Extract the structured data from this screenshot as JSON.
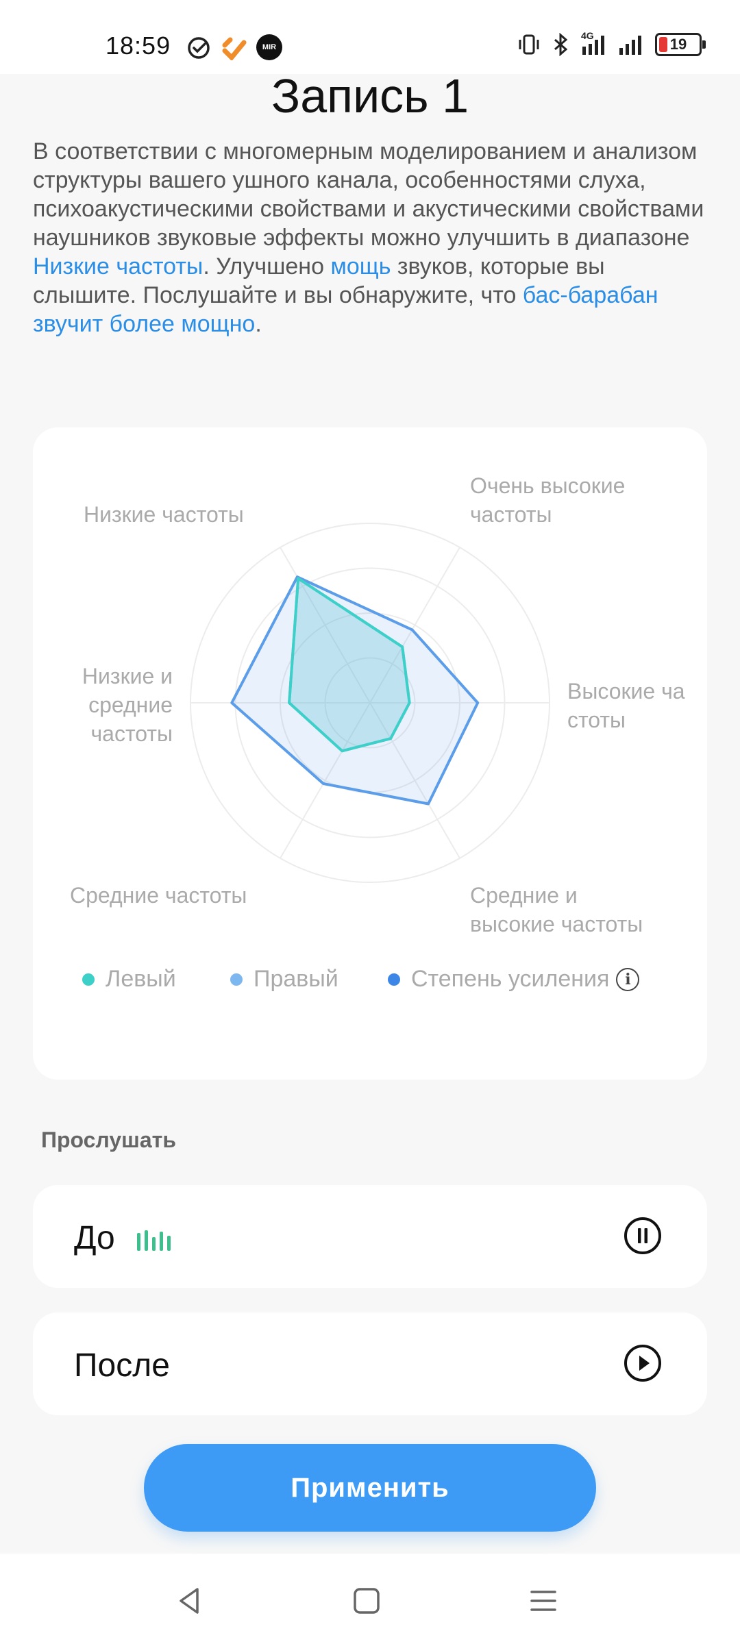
{
  "status_bar": {
    "time": "18:59",
    "network": "4G",
    "battery": "19",
    "left_icons": [
      "check-circle-icon",
      "payment-app-icon",
      "mir-icon"
    ],
    "right_icons": [
      "vibrate-icon",
      "bluetooth-icon",
      "signal-4g-icon",
      "signal-icon",
      "battery-icon"
    ],
    "mir_label": "MIR"
  },
  "page": {
    "title": "Запись 1",
    "description_parts": {
      "p1": "В соответствии с многомерным моделированием и анализом структуры вашего ушного канала, особенностями слуха, психоакустическими свойствами и акустическими свойствами наушников звуковые эффекты можно улучшить в диапазоне ",
      "hl1": "Низкие частоты",
      "p2": ". Улучшено ",
      "hl2": "мощь",
      "p3": " звуков, которые вы слышите. Послушайте и вы обнаружите, что ",
      "hl3": "бас-барабан звучит более мощно",
      "p4": "."
    },
    "highlight_color": "#2b8ee6"
  },
  "chart_data": {
    "type": "radar",
    "axes": [
      "Низкие частоты",
      "Очень высокие частоты",
      "Высокие частоты",
      "Средние и высокие частоты",
      "Средние частоты",
      "Низкие и средние частоты"
    ],
    "axis_labels_display": {
      "low": "Низкие частоты",
      "very_high_1": "Очень высокие",
      "very_high_2": "частоты",
      "high_1": "Высокие ча",
      "high_2": "стоты",
      "mid_high_1": "Средние и",
      "mid_high_2": "высокие частоты",
      "mid": "Средние частоты",
      "low_mid_1": "Низкие и",
      "low_mid_2": "средние",
      "low_mid_3": "частоты"
    },
    "rmax": 1.0,
    "rings": 4,
    "series": [
      {
        "name": "Левый",
        "color": "#3dd0c9",
        "values": [
          0.8,
          0.36,
          0.22,
          0.23,
          0.31,
          0.45
        ]
      },
      {
        "name": "Правый",
        "color": "#7cb8ef",
        "values": [
          0.8,
          0.36,
          0.22,
          0.23,
          0.31,
          0.45
        ]
      },
      {
        "name": "Степень усиления",
        "color": "#5b9de8",
        "values": [
          0.81,
          0.47,
          0.6,
          0.65,
          0.52,
          0.77
        ]
      }
    ],
    "legend": [
      "Левый",
      "Правый",
      "Степень усиления"
    ],
    "legend_colors": [
      "#3dd0c9",
      "#7cb8ef",
      "#3b86e6"
    ]
  },
  "listen": {
    "section_label": "Прослушать",
    "before_label": "До",
    "after_label": "После",
    "before_state": "playing",
    "after_state": "paused"
  },
  "apply_button": {
    "label": "Применить",
    "color": "#3d9af5"
  }
}
